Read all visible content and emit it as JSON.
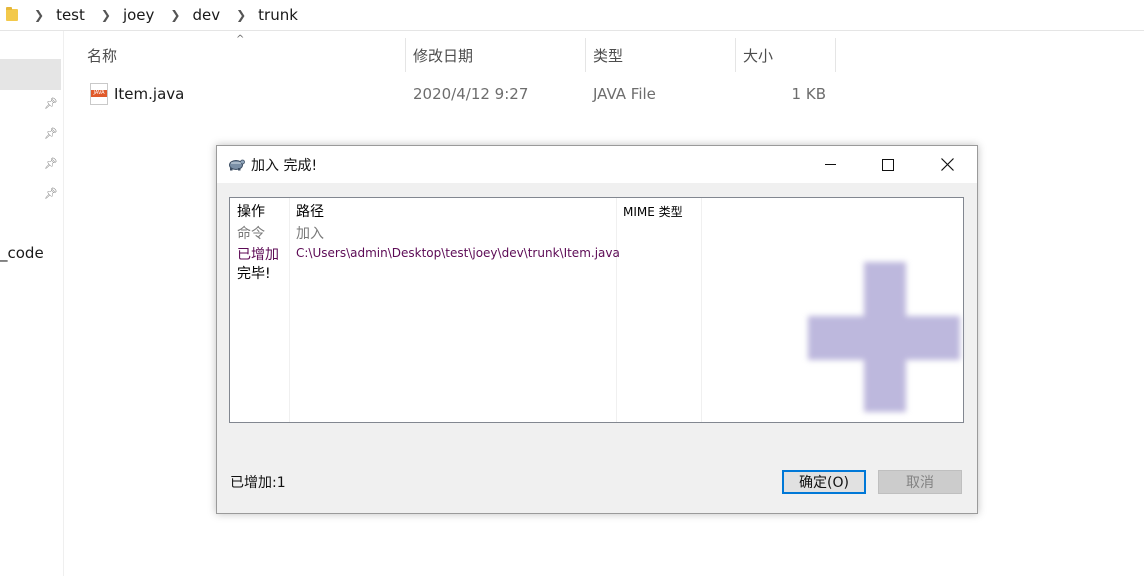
{
  "explorer": {
    "breadcrumbs": [
      "test",
      "joey",
      "dev",
      "trunk"
    ],
    "nav_partial_label": "_code",
    "columns": {
      "name": "名称",
      "modified": "修改日期",
      "type": "类型",
      "size": "大小"
    },
    "files": [
      {
        "name": "Item.java",
        "modified": "2020/4/12 9:27",
        "type": "JAVA File",
        "size": "1 KB",
        "icon_label": "JAVA"
      }
    ]
  },
  "dialog": {
    "title": "加入 完成!",
    "window_controls": {
      "minimize": "—",
      "maximize": "☐",
      "close": "✕"
    },
    "list": {
      "headers": {
        "action": "操作",
        "path": "路径",
        "mime": "MIME 类型"
      },
      "rows": [
        {
          "action": "命令",
          "path": "加入",
          "color": "#7a7a7a"
        },
        {
          "action": "已增加",
          "path": "C:\\Users\\admin\\Desktop\\test\\joey\\dev\\trunk\\Item.java",
          "color": "#5c0a55"
        },
        {
          "action": "完毕!",
          "path": "",
          "color": "#000000"
        }
      ]
    },
    "status": "已增加:1",
    "ok_button": "确定(O)",
    "cancel_button": "取消"
  }
}
